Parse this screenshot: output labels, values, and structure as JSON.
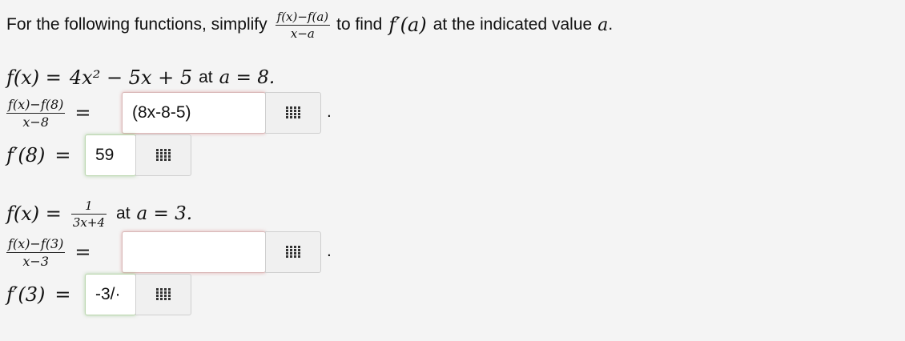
{
  "instruction": {
    "before": "For the following functions, simplify",
    "frac_num": "f(x)−f(a)",
    "frac_den": "x−a",
    "middle": "to find",
    "deriv": "f′(a)",
    "after": "at the indicated value",
    "var": "a",
    "end": "."
  },
  "problems": [
    {
      "func_lhs": "f(x) =",
      "func_rhs": "4x² − 5x + 5",
      "at_text": "at",
      "at_expr": "a = 8.",
      "quot_num": "f(x)−f(8)",
      "quot_den": "x−8",
      "eq": "=",
      "quotient_answer": "(8x-8-5)",
      "period": ".",
      "deriv_label": "f′(8)",
      "deriv_eq": "=",
      "deriv_answer": "59"
    },
    {
      "func_lhs": "f(x) =",
      "func_num": "1",
      "func_den": "3x+4",
      "at_text": "at",
      "at_expr": "a = 3.",
      "quot_num": "f(x)−f(3)",
      "quot_den": "x−3",
      "eq": "=",
      "quotient_answer": "",
      "period": ".",
      "deriv_label": "f′(3)",
      "deriv_eq": "=",
      "deriv_answer": "-3/·"
    }
  ]
}
